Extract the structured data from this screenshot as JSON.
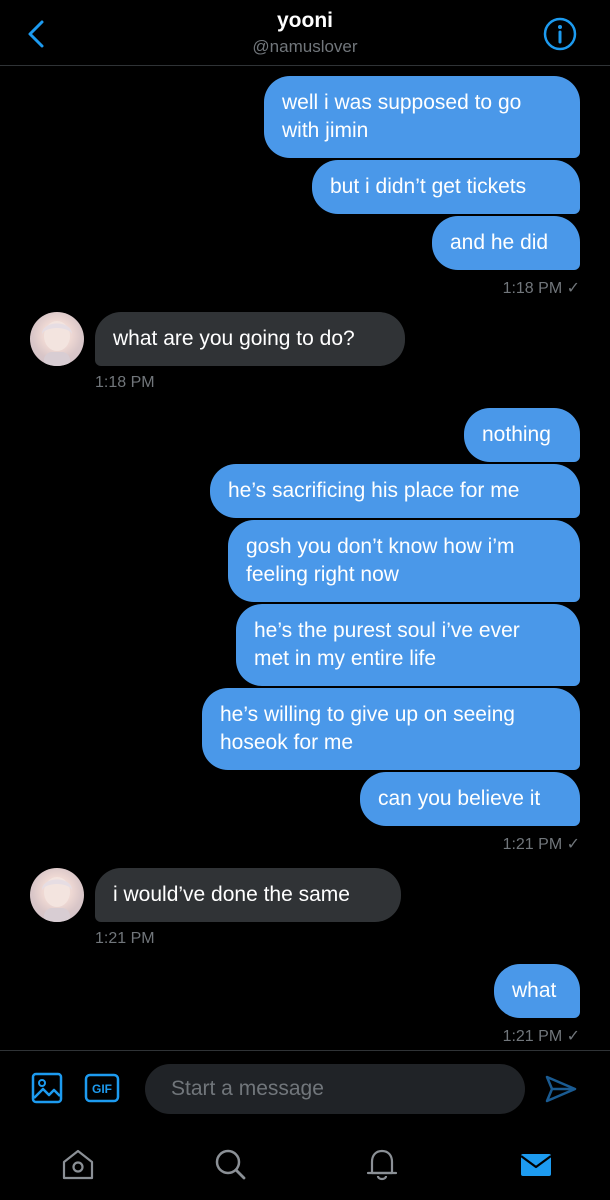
{
  "header": {
    "name": "yooni",
    "handle": "@namuslover",
    "back_icon": "chevron-left-icon",
    "info_icon": "info-circle-icon",
    "accent_color": "#1d9bf0"
  },
  "messages": {
    "group1": {
      "m1_line1": "well i was supposed to go",
      "m1_line2": "with jimin",
      "m2": "but i didn’t get tickets",
      "m3": "and he did",
      "time": "1:18 PM ✓"
    },
    "reply1": {
      "text": "what are you going to do?",
      "time": "1:18 PM"
    },
    "group2": {
      "m1": "nothing",
      "m2": "he’s sacrificing his place for me",
      "m3_line1": "gosh you don’t know how i’m",
      "m3_line2": "feeling right now",
      "m4_line1": "he’s the purest soul i’ve ever",
      "m4_line2": "met in my entire life",
      "m5_line1": "he’s willing to give up on seeing",
      "m5_line2": "hoseok for me",
      "m6": "can you believe it",
      "time": "1:21 PM ✓"
    },
    "reply2": {
      "text": "i would’ve done the same",
      "time": "1:21 PM"
    },
    "group3": {
      "m1": "what",
      "time": "1:21 PM ✓"
    },
    "outgoing_color": "#4a98e9",
    "incoming_color": "#303336"
  },
  "composer": {
    "placeholder": "Start a message",
    "gif_label": "GIF",
    "image_icon": "image-icon",
    "send_icon": "send-icon"
  },
  "tabbar": {
    "items": [
      "home-icon",
      "search-icon",
      "bell-icon",
      "mail-icon"
    ],
    "active": "mail-icon"
  }
}
